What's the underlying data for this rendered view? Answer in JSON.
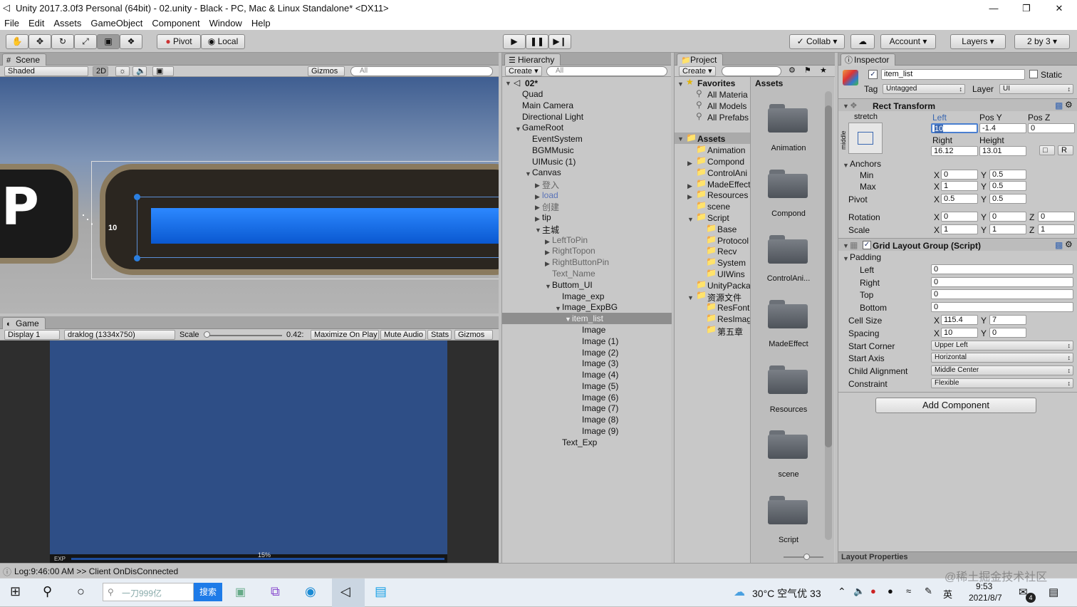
{
  "window": {
    "title": "Unity 2017.3.0f3 Personal (64bit) - 02.unity - Black - PC, Mac & Linux Standalone* <DX11>",
    "minimize": "—",
    "restore": "❐",
    "close": "✕"
  },
  "menu": [
    "File",
    "Edit",
    "Assets",
    "GameObject",
    "Component",
    "Window",
    "Help"
  ],
  "toolbar": {
    "pivot": "Pivot",
    "local": "Local",
    "collab": "Collab",
    "account": "Account",
    "layers": "Layers",
    "layout": "2 by 3"
  },
  "scene": {
    "tab": "Scene",
    "shaded": "Shaded",
    "mode2d": "2D",
    "gizmos": "Gizmos",
    "search": "All",
    "letter": "P",
    "offset": "10"
  },
  "game": {
    "tab": "Game",
    "display": "Display 1",
    "resolution": "draklog (1334x750)",
    "scale_label": "Scale",
    "scale_value": "0.42:",
    "maximize": "Maximize On Play",
    "mute": "Mute Audio",
    "stats": "Stats",
    "gizmos": "Gizmos",
    "exp": "EXP",
    "percent": "15%"
  },
  "hierarchy": {
    "tab": "Hierarchy",
    "create": "Create",
    "search": "All",
    "scene": "02*",
    "items": [
      "Quad",
      "Main Camera",
      "Directional Light",
      "GameRoot",
      "EventSystem",
      "BGMMusic",
      "UIMusic (1)",
      "Canvas",
      "登入",
      "load",
      "创建",
      "tip",
      "主城",
      "LeftToPin",
      "RightTopon",
      "RightButtonPin",
      "Text_Name",
      "Buttom_UI",
      "Image_exp",
      "Image_ExpBG",
      "item_list",
      "Image",
      "Image (1)",
      "Image (2)",
      "Image (3)",
      "Image (4)",
      "Image (5)",
      "Image (6)",
      "Image (7)",
      "Image (8)",
      "Image (9)",
      "Text_Exp"
    ]
  },
  "project": {
    "tab": "Project",
    "create": "Create",
    "favorites": "Favorites",
    "fav_items": [
      "All Materia",
      "All Models",
      "All Prefabs"
    ],
    "assets_header": "Assets",
    "assets_crumb": "Assets",
    "tree": [
      "Animation",
      "Compond",
      "ControlAni",
      "MadeEffect",
      "Resources",
      "scene",
      "Script",
      "Base",
      "Protocol",
      "Recv",
      "System",
      "UIWins",
      "UnityPacka",
      "资源文件",
      "ResFont",
      "ResImag",
      "第五章"
    ],
    "folders": [
      "Animation",
      "Compond",
      "ControlAni...",
      "MadeEffect",
      "Resources",
      "scene",
      "Script"
    ]
  },
  "inspector": {
    "tab": "Inspector",
    "name": "item_list",
    "static": "Static",
    "tag_label": "Tag",
    "tag": "Untagged",
    "layer_label": "Layer",
    "layer": "UI",
    "rect": {
      "title": "Rect Transform",
      "stretch": "stretch",
      "middle": "middle",
      "h_left": "Left",
      "h_posy": "Pos Y",
      "h_posz": "Pos Z",
      "left": "10",
      "posy": "-1.4",
      "posz": "0",
      "h_right": "Right",
      "h_height": "Height",
      "right": "16.12",
      "height": "13.01",
      "r": "R",
      "anchors": "Anchors",
      "min": "Min",
      "max": "Max",
      "min_x": "0",
      "min_y": "0.5",
      "max_x": "1",
      "max_y": "0.5",
      "pivot": "Pivot",
      "pivot_x": "0.5",
      "pivot_y": "0.5",
      "rotation": "Rotation",
      "rot_x": "0",
      "rot_y": "0",
      "rot_z": "0",
      "scale": "Scale",
      "sc_x": "1",
      "sc_y": "1",
      "sc_z": "1",
      "x": "X",
      "y": "Y",
      "z": "Z"
    },
    "grid": {
      "title": "Grid Layout Group (Script)",
      "padding": "Padding",
      "left": "Left",
      "right": "Right",
      "top": "Top",
      "bottom": "Bottom",
      "pl": "0",
      "pr": "0",
      "pt": "0",
      "pb": "0",
      "cell": "Cell Size",
      "cell_x": "115.4",
      "cell_y": "7",
      "spacing": "Spacing",
      "sp_x": "10",
      "sp_y": "0",
      "corner": "Start Corner",
      "corner_v": "Upper Left",
      "axis": "Start Axis",
      "axis_v": "Horizontal",
      "align": "Child Alignment",
      "align_v": "Middle Center",
      "constraint": "Constraint",
      "constraint_v": "Flexible"
    },
    "add": "Add Component",
    "layout_props": "Layout Properties"
  },
  "status": "Log:9:46:00 AM >> Client OnDisConnected",
  "taskbar": {
    "search": "一刀999亿",
    "search_btn": "搜索",
    "weather": "30°C 空气优 33",
    "ime": "英",
    "time": "9:53",
    "date": "2021/8/7",
    "notif": "4",
    "watermark": "@稀土掘金技术社区"
  }
}
